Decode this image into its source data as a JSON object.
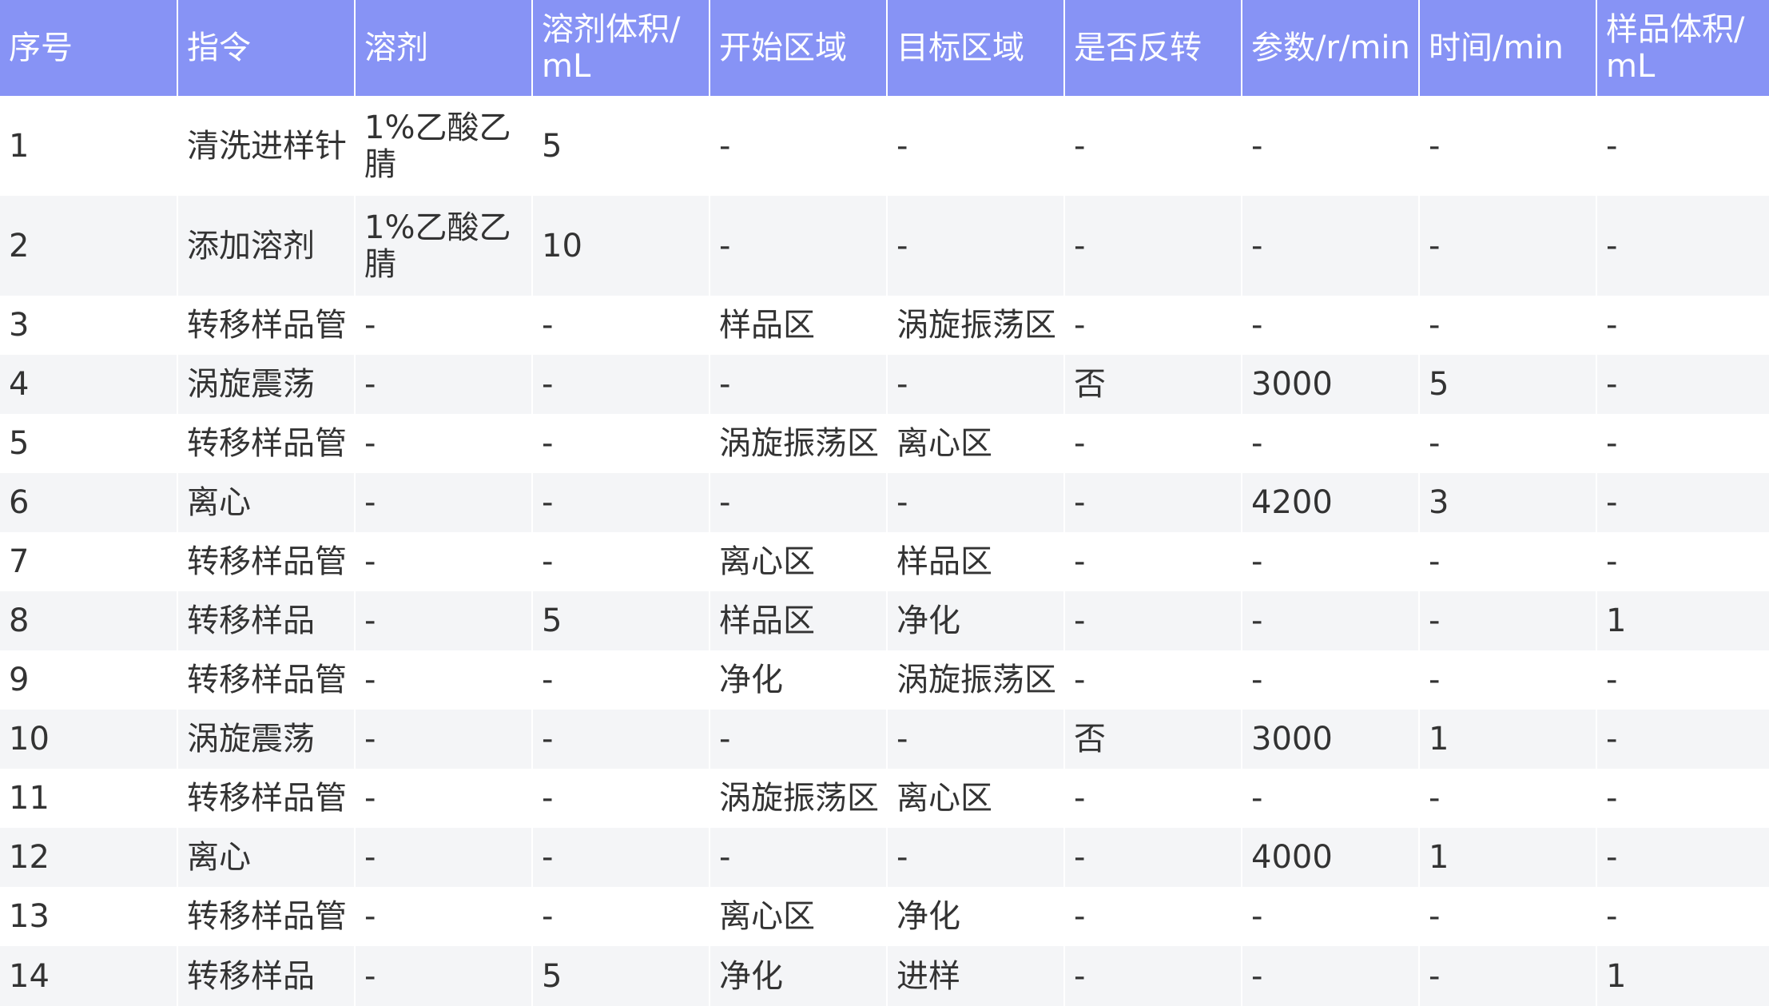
{
  "table": {
    "headers": [
      "序号",
      "指令",
      "溶剂",
      "溶剂体积/\nmL",
      "开始区域",
      "目标区域",
      "是否反转",
      "参数/r/min",
      "时间/min",
      "样品体积/\nmL"
    ],
    "rows": [
      [
        "1",
        "清洗进样针",
        "1%乙酸乙\n腈",
        "5",
        "-",
        "-",
        "-",
        "-",
        "-",
        "-"
      ],
      [
        "2",
        "添加溶剂",
        "1%乙酸乙\n腈",
        "10",
        "-",
        "-",
        "-",
        "-",
        "-",
        "-"
      ],
      [
        "3",
        "转移样品管",
        "-",
        "-",
        "样品区",
        "涡旋振荡区",
        "-",
        "-",
        "-",
        "-"
      ],
      [
        "4",
        "涡旋震荡",
        "-",
        "-",
        "-",
        "-",
        "否",
        "3000",
        "5",
        "-"
      ],
      [
        "5",
        "转移样品管",
        "-",
        "-",
        "涡旋振荡区",
        "离心区",
        "-",
        "-",
        "-",
        "-"
      ],
      [
        "6",
        "离心",
        "-",
        "-",
        "-",
        "-",
        "-",
        "4200",
        "3",
        "-"
      ],
      [
        "7",
        "转移样品管",
        "-",
        "-",
        "离心区",
        "样品区",
        "-",
        "-",
        "-",
        "-"
      ],
      [
        "8",
        "转移样品",
        "-",
        "5",
        "样品区",
        "净化",
        "-",
        "-",
        "-",
        "1"
      ],
      [
        "9",
        "转移样品管",
        "-",
        "-",
        "净化",
        "涡旋振荡区",
        "-",
        "-",
        "-",
        "-"
      ],
      [
        "10",
        "涡旋震荡",
        "-",
        "-",
        "-",
        "-",
        "否",
        "3000",
        "1",
        "-"
      ],
      [
        "11",
        "转移样品管",
        "-",
        "-",
        "涡旋振荡区",
        "离心区",
        "-",
        "-",
        "-",
        "-"
      ],
      [
        "12",
        "离心",
        "-",
        "-",
        "-",
        "-",
        "-",
        "4000",
        "1",
        "-"
      ],
      [
        "13",
        "转移样品管",
        "-",
        "-",
        "离心区",
        "净化",
        "-",
        "-",
        "-",
        "-"
      ],
      [
        "14",
        "转移样品",
        "-",
        "5",
        "净化",
        "进样",
        "-",
        "-",
        "-",
        "1"
      ]
    ]
  },
  "colors": {
    "header_bg": "#8793f5",
    "header_text": "#ffffff",
    "row_alt_bg": "#f4f5f7",
    "row_bg": "#ffffff",
    "body_text": "#333333"
  }
}
